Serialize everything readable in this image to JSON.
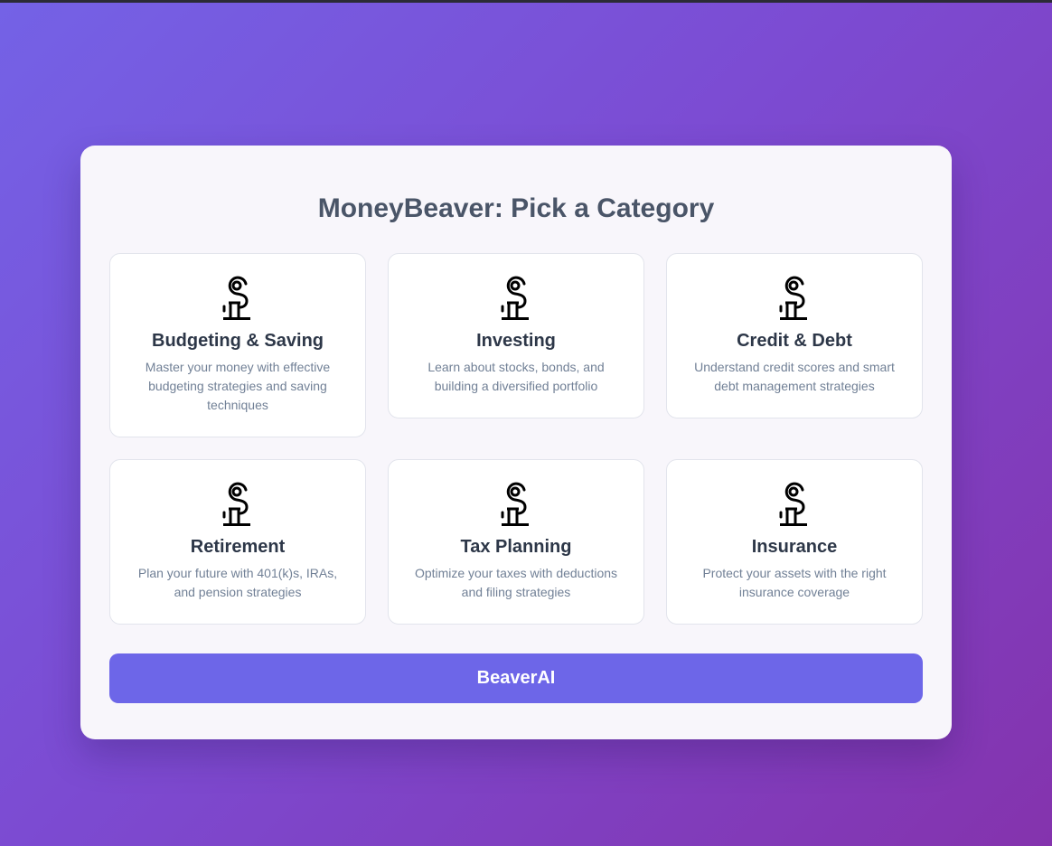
{
  "page": {
    "title": "MoneyBeaver: Pick a Category"
  },
  "categories": [
    {
      "icon": "dollar-sign-icon",
      "title": "Budgeting & Saving",
      "description": "Master your money with effective budgeting strategies and saving techniques"
    },
    {
      "icon": "dollar-sign-icon",
      "title": "Investing",
      "description": "Learn about stocks, bonds, and building a diversified portfolio"
    },
    {
      "icon": "dollar-sign-icon",
      "title": "Credit & Debt",
      "description": "Understand credit scores and smart debt management strategies"
    },
    {
      "icon": "dollar-sign-icon",
      "title": "Retirement",
      "description": "Plan your future with 401(k)s, IRAs, and pension strategies"
    },
    {
      "icon": "dollar-sign-icon",
      "title": "Tax Planning",
      "description": "Optimize your taxes with deductions and filing strategies"
    },
    {
      "icon": "dollar-sign-icon",
      "title": "Insurance",
      "description": "Protect your assets with the right insurance coverage"
    }
  ],
  "cta": {
    "label": "BeaverAI"
  },
  "colors": {
    "background_start": "#7462e6",
    "background_end": "#8433ad",
    "panel": "#f8f6fb",
    "button": "#6d66e8",
    "title_text": "#4a5568",
    "card_title_text": "#2d3748",
    "card_desc_text": "#718096"
  }
}
